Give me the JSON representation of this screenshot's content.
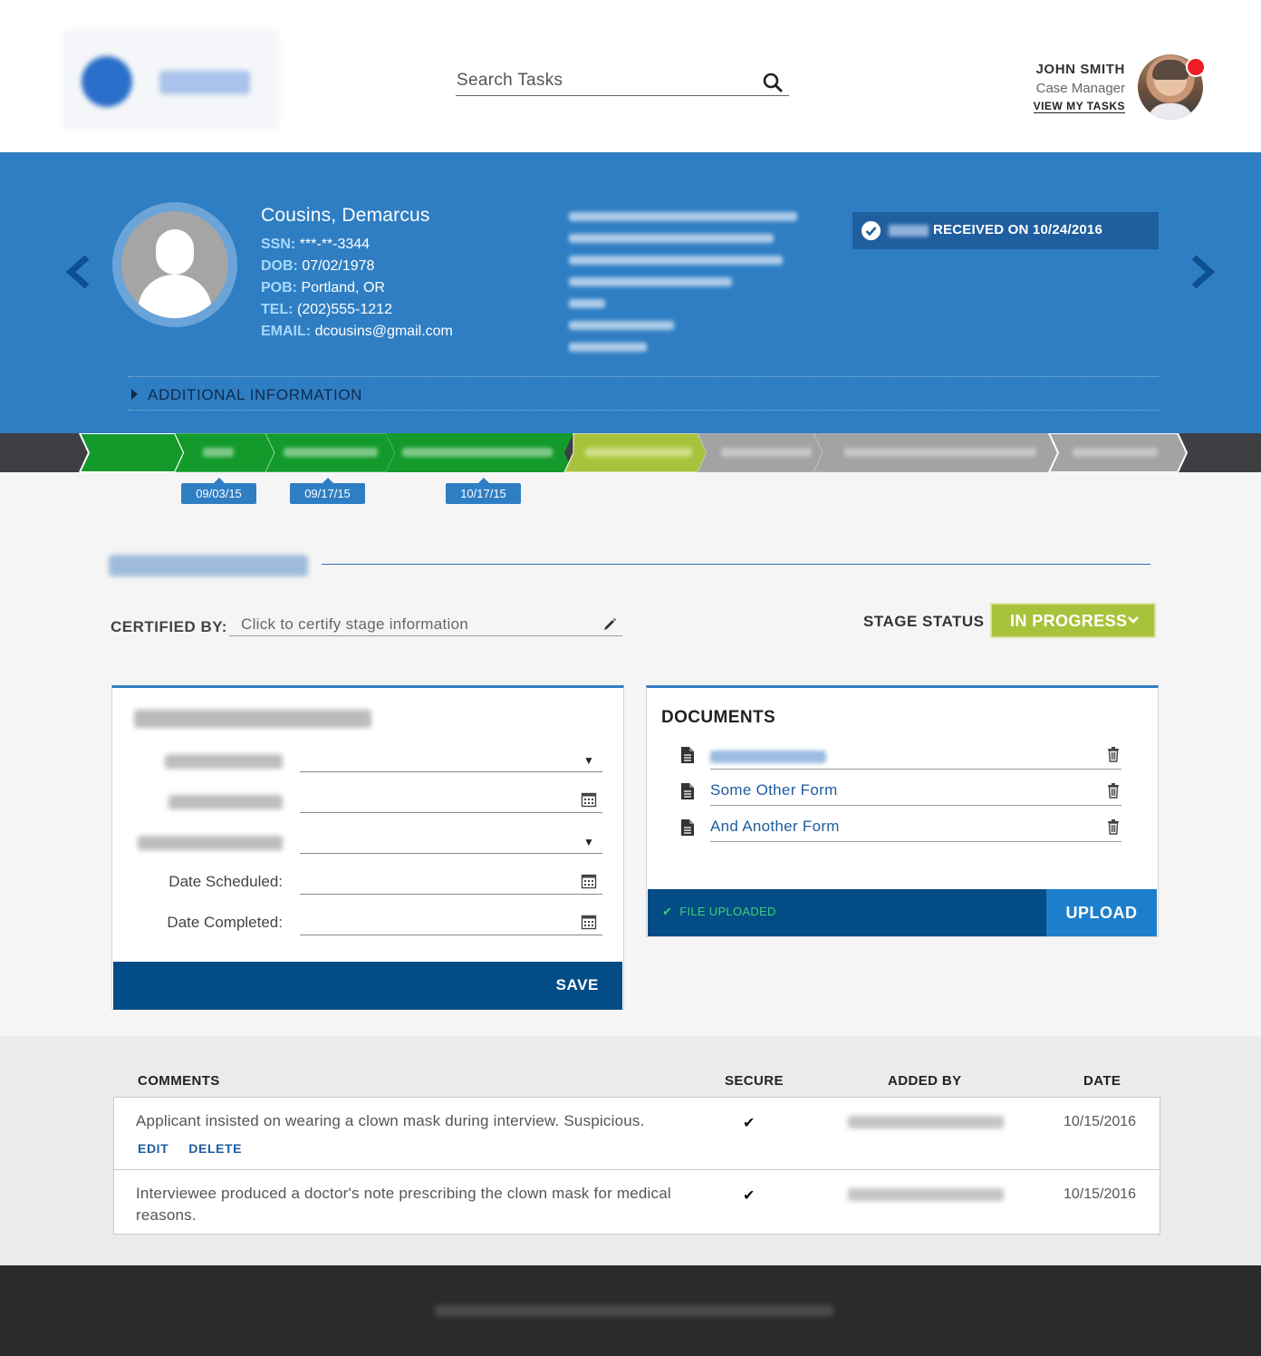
{
  "header": {
    "search_placeholder": "Search Tasks",
    "user": {
      "name": "JOHN SMITH",
      "role": "Case Manager",
      "tasks_link": "VIEW MY TASKS"
    }
  },
  "applicant": {
    "name": "Cousins, Demarcus",
    "fields": [
      {
        "label": "SSN:",
        "value": "***-**-3344"
      },
      {
        "label": "DOB:",
        "value": "07/02/1978"
      },
      {
        "label": "POB:",
        "value": "Portland, OR"
      },
      {
        "label": "TEL:",
        "value": "(202)555-1212"
      },
      {
        "label": "EMAIL:",
        "value": "dcousins@gmail.com"
      }
    ],
    "received": "RECEIVED ON 10/24/2016",
    "additional_info": "ADDITIONAL INFORMATION"
  },
  "stages": {
    "dates": [
      "09/03/15",
      "09/17/15",
      "10/17/15"
    ],
    "colors": {
      "complete": "#139a2b",
      "current": "#a9c23b",
      "pending": "#a3a3a3"
    }
  },
  "stage_section": {
    "certified_label": "CERTIFIED BY:",
    "certified_placeholder": "Click to certify stage information",
    "status_label": "STAGE STATUS",
    "status_value": "IN PROGRESS"
  },
  "assignment": {
    "fields": [
      {
        "label": "Date Scheduled:"
      },
      {
        "label": "Date Completed:"
      }
    ],
    "save_label": "SAVE"
  },
  "documents": {
    "title": "DOCUMENTS",
    "items": [
      "Some Other Form",
      "And Another Form"
    ],
    "uploaded_status": "FILE UPLOADED",
    "upload_label": "UPLOAD"
  },
  "comments": {
    "headers": {
      "comments": "COMMENTS",
      "secure": "SECURE",
      "added_by": "ADDED BY",
      "date": "DATE"
    },
    "rows": [
      {
        "text": "Applicant insisted on wearing a clown mask during interview. Suspicious.",
        "secure": "✔",
        "date": "10/15/2016",
        "edit": "EDIT",
        "delete": "DELETE"
      },
      {
        "text": "Interviewee produced a doctor's note prescribing the clown mask for medical reasons.",
        "secure": "✔",
        "date": "10/15/2016"
      }
    ]
  }
}
